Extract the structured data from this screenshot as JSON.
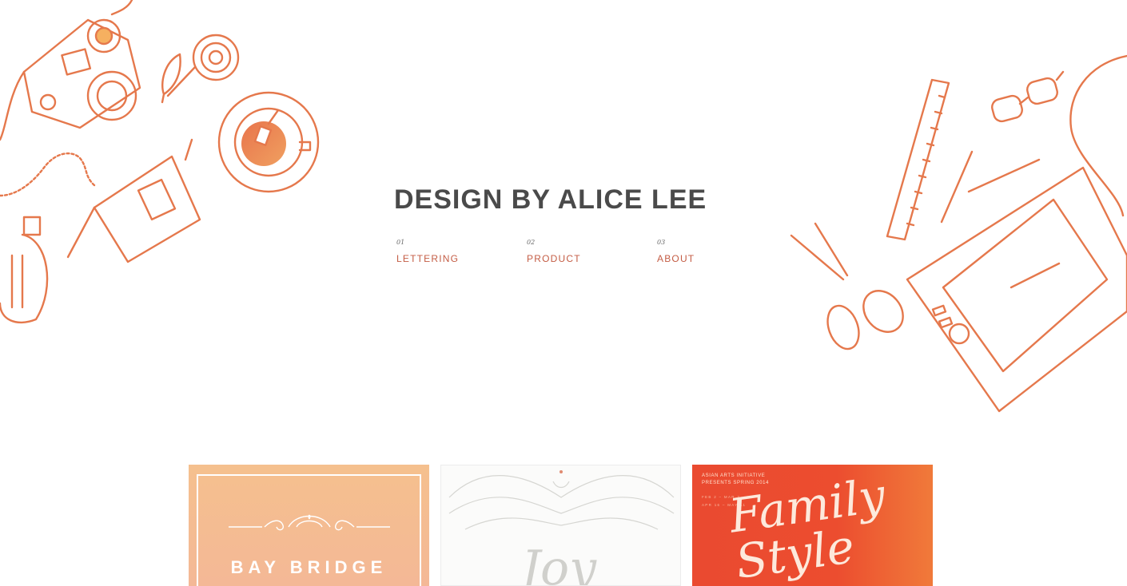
{
  "header": {
    "title": "DESIGN BY ALICE LEE"
  },
  "nav": {
    "items": [
      {
        "num": "01",
        "label": "LETTERING"
      },
      {
        "num": "02",
        "label": "PRODUCT"
      },
      {
        "num": "03",
        "label": "ABOUT"
      }
    ]
  },
  "portfolio": {
    "items": [
      {
        "title": "BAY BRIDGE"
      },
      {
        "script": "Joy"
      },
      {
        "header": "ASIAN ARTS INITIATIVE\nPRESENTS SPRING 2014",
        "dates": "FEB 2 – MAR 2\nAPR 16 – MAY 11",
        "script": "Family\nStyle"
      }
    ]
  },
  "colors": {
    "accent": "#c45d45",
    "illustration": "#e5774b",
    "title": "#4a4a4a"
  },
  "icons": {
    "left": [
      "camera-icon",
      "flower-icon",
      "leaf-icon",
      "teacup-icon",
      "necklace-icon",
      "notebook-icon",
      "lightbulb-icon"
    ],
    "right": [
      "ruler-icon",
      "glasses-icon",
      "pencil-icon",
      "scissors-icon",
      "tablet-icon"
    ]
  }
}
